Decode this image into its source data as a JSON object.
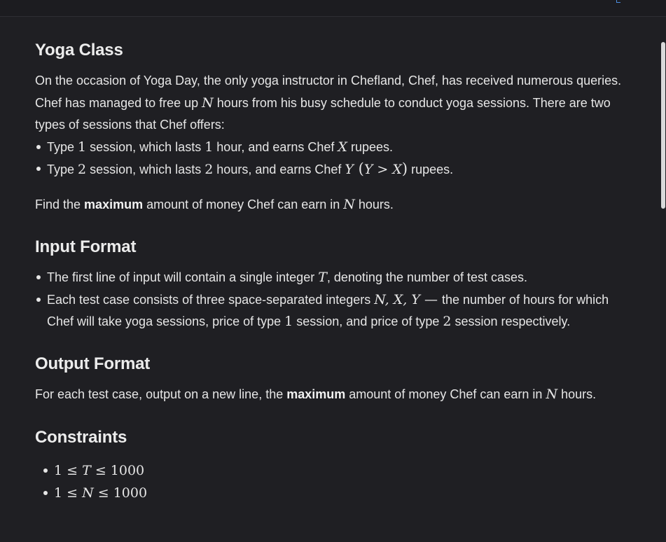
{
  "problem": {
    "title": "Yoga Class",
    "statement": {
      "p1": "On the occasion of Yoga Day, the only yoga instructor in Chefland, Chef, has received numerous queries.",
      "p2_pre": "Chef has managed to free up ",
      "p2_var": "N",
      "p2_post": " hours from his busy schedule to conduct yoga sessions. There are two types of sessions that Chef offers:",
      "bullets": [
        {
          "pre": "Type ",
          "num": "1",
          "mid": " session, which lasts ",
          "dur": "1",
          "mid2": " hour, and earns Chef ",
          "var": "X",
          "post": " rupees."
        },
        {
          "pre": "Type ",
          "num": "2",
          "mid": " session, which lasts ",
          "dur": "2",
          "mid2": " hours, and earns Chef ",
          "var": "Y",
          "cond_open": " (",
          "cond_left": "Y",
          "cond_op": " > ",
          "cond_right": "X",
          "cond_close": ")",
          "post": " rupees."
        }
      ],
      "find_pre": "Find the ",
      "find_bold": "maximum",
      "find_mid": " amount of money Chef can earn in ",
      "find_var": "N",
      "find_post": " hours."
    },
    "input_format": {
      "title": "Input Format",
      "items": [
        {
          "pre": "The first line of input will contain a single integer ",
          "var": "T",
          "post": ", denoting the number of test cases."
        },
        {
          "pre": "Each test case consists of three space-separated integers ",
          "vars": "N, X, Y",
          "dash": " — ",
          "mid": "the number of hours for which Chef will take yoga sessions, price of type ",
          "n1": "1",
          "mid2": " session, and price of type ",
          "n2": "2",
          "post": " session respectively."
        }
      ]
    },
    "output_format": {
      "title": "Output Format",
      "pre": "For each test case, output on a new line, the ",
      "bold": "maximum",
      "mid": " amount of money Chef can earn in ",
      "var": "N",
      "post": " hours."
    },
    "constraints": {
      "title": "Constraints",
      "items": [
        {
          "lo": "1",
          "op1": " ≤ ",
          "var": "T",
          "op2": " ≤ ",
          "hi": "1000"
        },
        {
          "lo": "1",
          "op1": " ≤ ",
          "var": "N",
          "op2": " ≤ ",
          "hi": "1000"
        }
      ]
    }
  }
}
